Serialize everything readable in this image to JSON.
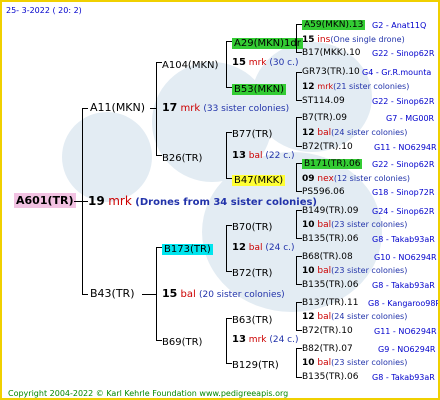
{
  "header": "25-  3-2022 ( 20:  2)",
  "footer": "Copyright 2004-2022 © Karl Kehrle Foundation    www.pedigreeapis.org",
  "root": {
    "name": "A601(TR)",
    "num": "19",
    "code": "mrk",
    "note": "(Drones from 34 sister colonies)"
  },
  "gen1": [
    {
      "name": "A11(MKN)",
      "num": "17",
      "code": "mrk",
      "note": "(33 sister colonies)"
    },
    {
      "name": "B43(TR)",
      "num": "15",
      "code": "bal",
      "note": "(20 sister colonies)"
    }
  ],
  "gen2": [
    {
      "name": "A104(MKN)",
      "num": "15",
      "code": "mrk",
      "note": "(30 c.)"
    },
    {
      "name": "B26(TR)",
      "num": "13",
      "code": "bal",
      "note": "(22 c.)"
    },
    {
      "name": "B173(TR)",
      "num": "12",
      "code": "bal",
      "note": "(24 c.)"
    },
    {
      "name": "B69(TR)",
      "num": "13",
      "code": "mrk",
      "note": "(24 c.)"
    }
  ],
  "gen3": [
    {
      "name": "A29(MKN)1dr",
      "num": "15",
      "code": "ins",
      "note": "(One single drone)"
    },
    {
      "name": "B53(MKN)",
      "num": "12",
      "code": "mrk",
      "note": "(21 sister colonies)"
    },
    {
      "name": "B77(TR)",
      "num": "12",
      "code": "bal",
      "note": "(24 sister colonies)"
    },
    {
      "name": "B47(MKK)",
      "num": "09",
      "code": "nex",
      "note": "(12 sister colonies)"
    },
    {
      "name": "B70(TR)",
      "num": "10",
      "code": "bal",
      "note": "(23 sister colonies)"
    },
    {
      "name": "B72(TR)",
      "num": "10",
      "code": "bal",
      "note": "(23 sister colonies)"
    },
    {
      "name": "B63(TR)",
      "num": "12",
      "code": "bal",
      "note": "(24 sister colonies)"
    },
    {
      "name": "B129(TR)",
      "num": "10",
      "code": "bal",
      "note": "(23 sister colonies)"
    }
  ],
  "gen4": [
    {
      "left": "A59(MKN).13",
      "right": "G2 - Anat11Q"
    },
    {
      "left": "B17(MKK).10",
      "right": "G22 - Sinop62R"
    },
    {
      "left": "GR73(TR).10",
      "right": "G4 - Gr.R.mounta"
    },
    {
      "left": "ST114.09",
      "right": "G22 - Sinop62R"
    },
    {
      "left": "B7(TR).09",
      "right": "G7 - MG00R"
    },
    {
      "left": "B72(TR).10",
      "right": "G11 - NO6294R"
    },
    {
      "left": "B171(TR).06",
      "right": "G22 - Sinop62R"
    },
    {
      "left": "PS596.06",
      "right": "G18 - Sinop72R"
    },
    {
      "left": "B149(TR).09",
      "right": "G24 - Sinop62R"
    },
    {
      "left": "B135(TR).06",
      "right": "G8 - Takab93aR"
    },
    {
      "left": "B68(TR).08",
      "right": "G10 - NO6294R"
    },
    {
      "left": "B135(TR).06",
      "right": "G8 - Takab93aR"
    },
    {
      "left": "B137(TR).11",
      "right": "G8 - Kangaroo98R"
    },
    {
      "left": "B72(TR).10",
      "right": "G11 - NO6294R"
    },
    {
      "left": "B82(TR).07",
      "right": "G9 - NO6294R"
    },
    {
      "left": "B135(TR).06",
      "right": "G8 - Takab93aR"
    }
  ]
}
